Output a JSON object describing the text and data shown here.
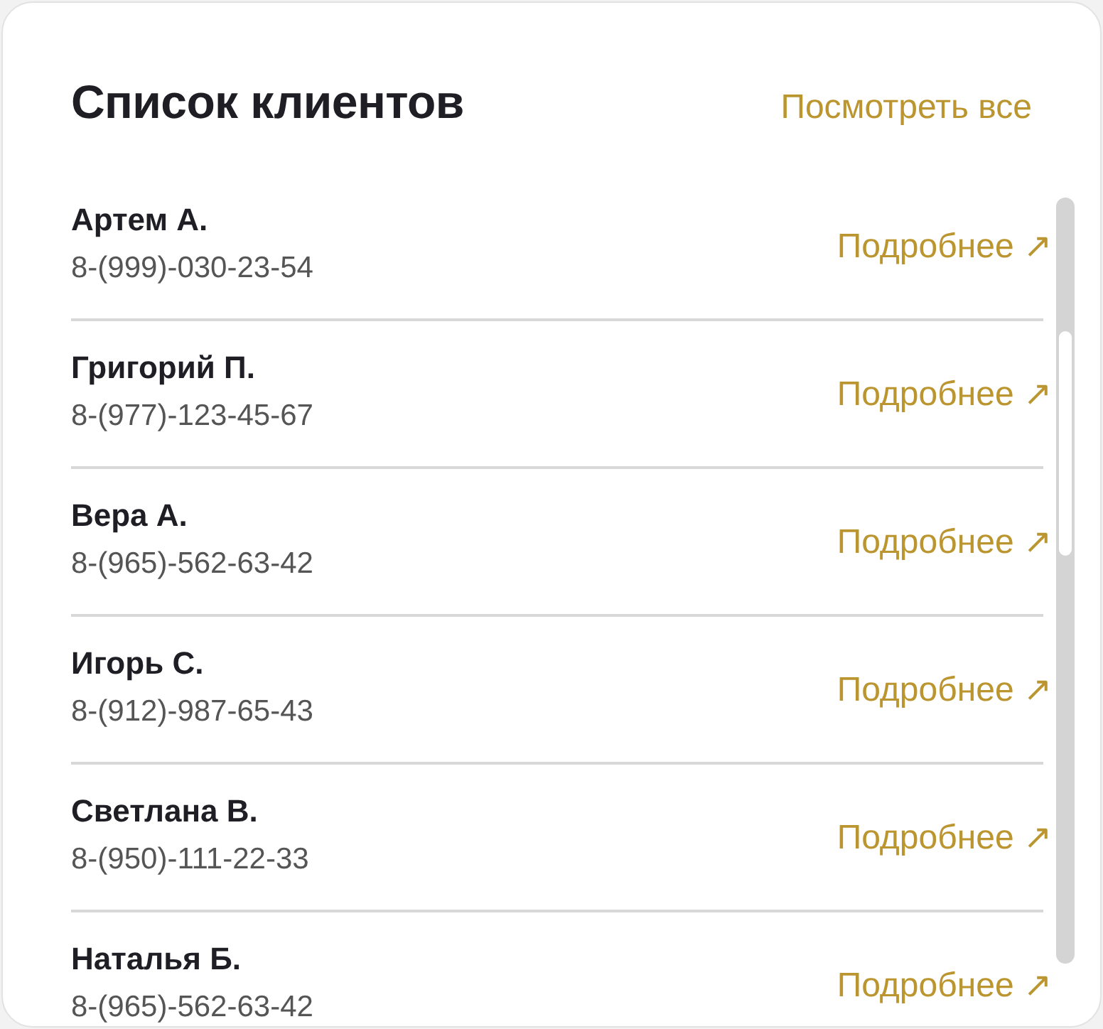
{
  "header": {
    "title": "Список клиентов",
    "view_all": "Посмотреть все"
  },
  "clients": [
    {
      "name": "Артем А.",
      "phone": "8-(999)-030-23-54",
      "link": "Подробнее ↗"
    },
    {
      "name": "Григорий П.",
      "phone": "8-(977)-123-45-67",
      "link": "Подробнее ↗"
    },
    {
      "name": "Вера А.",
      "phone": "8-(965)-562-63-42",
      "link": "Подробнее ↗"
    },
    {
      "name": "Игорь С.",
      "phone": "8-(912)-987-65-43",
      "link": "Подробнее ↗"
    },
    {
      "name": "Светлана В.",
      "phone": "8-(950)-111-22-33",
      "link": "Подробнее ↗"
    },
    {
      "name": "Наталья Б.",
      "phone": "8-(965)-562-63-42",
      "link": "Подробнее ↗"
    }
  ]
}
